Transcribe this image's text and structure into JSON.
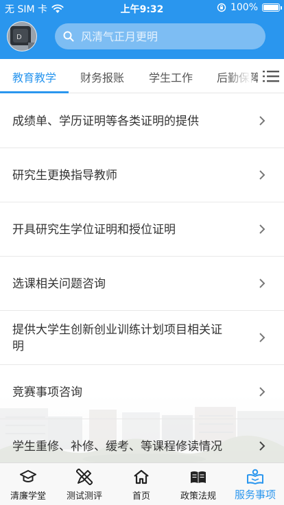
{
  "status_bar": {
    "carrier": "无 SIM 卡",
    "time": "上午9:32",
    "battery": "100%"
  },
  "search": {
    "placeholder": "风清气正月更明"
  },
  "tabs": [
    {
      "label": "教育教学",
      "active": true
    },
    {
      "label": "财务报账",
      "active": false
    },
    {
      "label": "学生工作",
      "active": false
    },
    {
      "label": "后勤保障",
      "active": false
    }
  ],
  "list": {
    "items": [
      {
        "label": "成绩单、学历证明等各类证明的提供"
      },
      {
        "label": "研究生更换指导教师"
      },
      {
        "label": "开具研究生学位证明和授位证明"
      },
      {
        "label": "选课相关问题咨询"
      },
      {
        "label": "提供大学生创新创业训练计划项目相关证明"
      },
      {
        "label": "竞赛事项咨询"
      },
      {
        "label": "学生重修、补修、缓考、等课程修读情况"
      }
    ]
  },
  "tab_bar": {
    "items": [
      {
        "label": "清廉学堂",
        "icon": "graduation-cap-icon",
        "active": false
      },
      {
        "label": "测试测评",
        "icon": "pencil-ruler-icon",
        "active": false
      },
      {
        "label": "首页",
        "icon": "home-icon",
        "active": false
      },
      {
        "label": "政策法规",
        "icon": "book-icon",
        "active": false
      },
      {
        "label": "服务事项",
        "icon": "service-book-icon",
        "active": true
      }
    ]
  },
  "colors": {
    "accent": "#2a96ee",
    "search_bg": "#7dbdf3",
    "text": "#333333"
  }
}
